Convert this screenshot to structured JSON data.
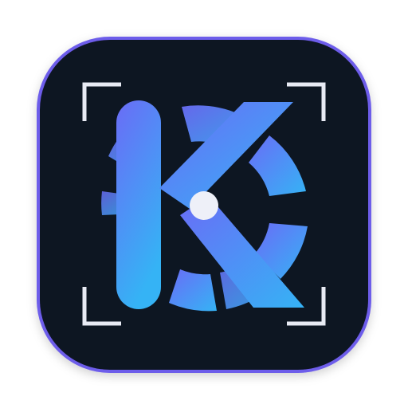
{
  "icon": {
    "name": "app-icon",
    "glyph": "K",
    "colors": {
      "tile_background": "#0e1322",
      "tile_border": "#6d5dea",
      "gradient_start": "#6a6cf6",
      "gradient_end": "#35b3f5",
      "center_dot": "#eef0f8",
      "corner_brackets": "#e8ebf4"
    }
  }
}
